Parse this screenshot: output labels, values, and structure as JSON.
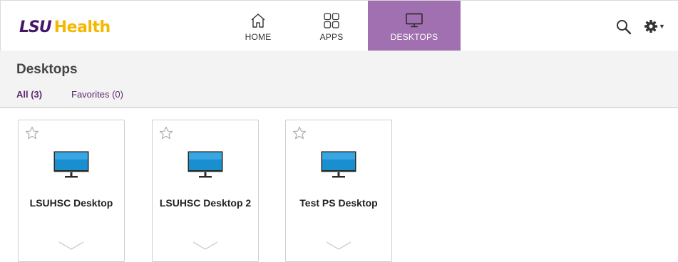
{
  "brand": {
    "lsu": "LSU",
    "health": "Health"
  },
  "nav": {
    "home": {
      "label": "HOME",
      "icon": "home-icon"
    },
    "apps": {
      "label": "APPS",
      "icon": "apps-grid-icon"
    },
    "desktops": {
      "label": "DESKTOPS",
      "icon": "monitor-icon",
      "active": true
    }
  },
  "colors": {
    "brand_purple": "#46166b",
    "brand_gold": "#f5b800",
    "active_nav": "#a070b0",
    "monitor_screen": "#1a8fd0"
  },
  "page": {
    "title": "Desktops",
    "filters": {
      "all": "All (3)",
      "favorites": "Favorites (0)"
    }
  },
  "desktops": [
    {
      "name": "LSUHSC Desktop"
    },
    {
      "name": "LSUHSC Desktop 2"
    },
    {
      "name": "Test PS Desktop"
    }
  ]
}
